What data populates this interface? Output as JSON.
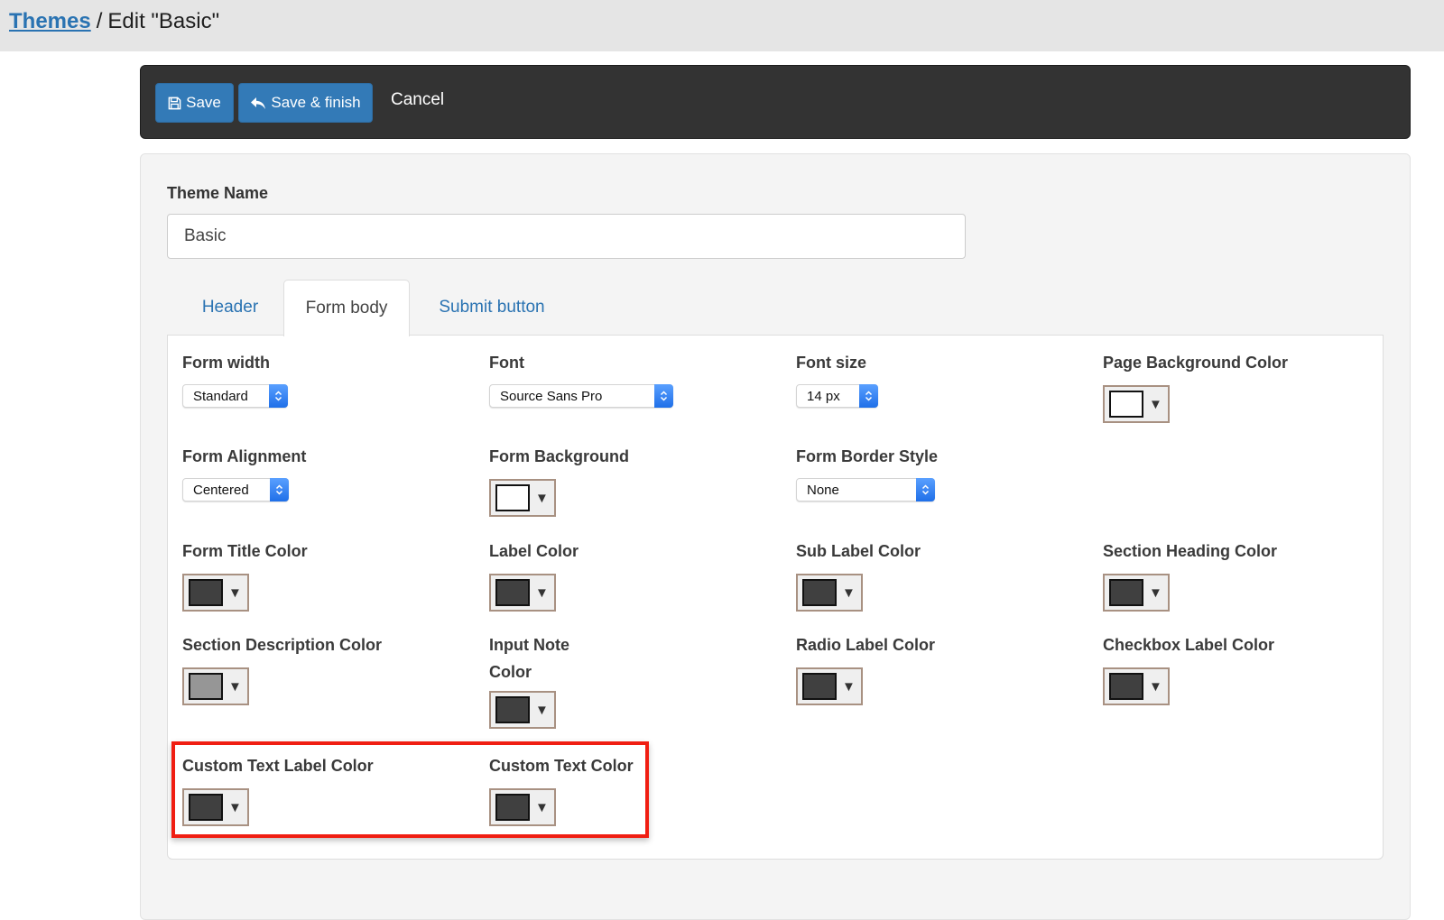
{
  "breadcrumb": {
    "parent": "Themes",
    "separator": "/",
    "current": "Edit \"Basic\""
  },
  "toolbar": {
    "save_label": "Save",
    "save_icon": "floppy-disk-icon",
    "save_finish_label": "Save & finish",
    "save_finish_icon": "reply-arrow-icon",
    "cancel_label": "Cancel"
  },
  "theme_name": {
    "label": "Theme Name",
    "value": "Basic"
  },
  "tabs": [
    {
      "label": "Header",
      "active": false
    },
    {
      "label": "Form body",
      "active": true
    },
    {
      "label": "Submit button",
      "active": false
    }
  ],
  "form_body": {
    "form_width": {
      "label": "Form width",
      "value": "Standard"
    },
    "font": {
      "label": "Font",
      "value": "Source Sans Pro"
    },
    "font_size": {
      "label": "Font size",
      "value": "14 px"
    },
    "page_background_color": {
      "label": "Page Background Color",
      "color": "#ffffff"
    },
    "form_alignment": {
      "label": "Form Alignment",
      "value": "Centered"
    },
    "form_background": {
      "label": "Form Background",
      "color": "#ffffff"
    },
    "form_border_style": {
      "label": "Form Border Style",
      "value": "None"
    },
    "form_title_color": {
      "label": "Form Title Color",
      "color": "#404040"
    },
    "label_color": {
      "label": "Label Color",
      "color": "#404040"
    },
    "sub_label_color": {
      "label": "Sub Label Color",
      "color": "#404040"
    },
    "section_heading_color": {
      "label": "Section Heading Color",
      "color": "#404040"
    },
    "section_description_color": {
      "label": "Section Description Color",
      "color": "#969696"
    },
    "input_note_color": {
      "label_line1": "Input Note",
      "label_line2": "Color",
      "color": "#404040"
    },
    "radio_label_color": {
      "label": "Radio Label Color",
      "color": "#404040"
    },
    "checkbox_label_color": {
      "label": "Checkbox Label Color",
      "color": "#404040"
    },
    "custom_text_label_color": {
      "label": "Custom Text Label Color",
      "color": "#404040"
    },
    "custom_text_color": {
      "label": "Custom Text Color",
      "color": "#404040"
    }
  },
  "caret_glyph": "▼",
  "colors": {
    "accent": "#337ab7",
    "link": "#2a73b2",
    "toolbar_bg": "#333333",
    "highlight": "#f01e12"
  }
}
